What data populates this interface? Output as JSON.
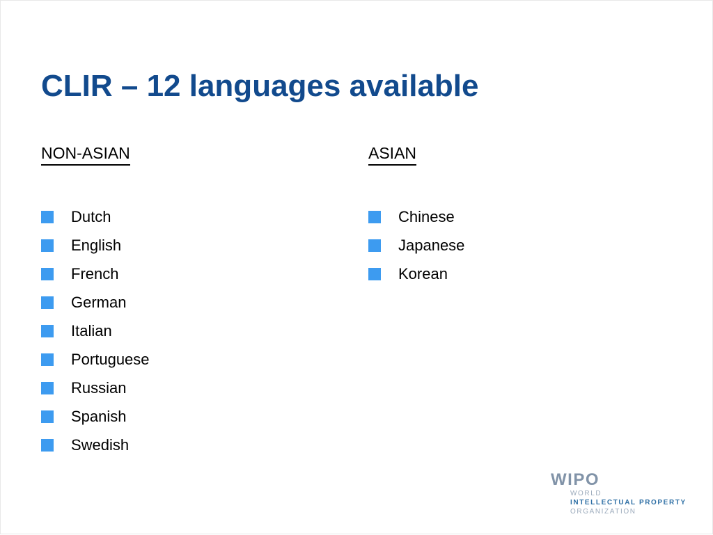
{
  "slide": {
    "title": "CLIR – 12 languages available",
    "title_color": "#124A8D",
    "background_color": "#ffffff",
    "bullet_color": "#3D9BF0"
  },
  "columns": [
    {
      "header": "NON-ASIAN",
      "items": [
        "Dutch",
        "English",
        "French",
        "German",
        "Italian",
        "Portuguese",
        "Russian",
        "Spanish",
        "Swedish"
      ]
    },
    {
      "header": "ASIAN",
      "items": [
        "Chinese",
        "Japanese",
        "Korean"
      ]
    }
  ],
  "logo": {
    "acronym": "WIPO",
    "line1": "WORLD",
    "line2": "INTELLECTUAL PROPERTY",
    "line3": "ORGANIZATION",
    "acronym_color": "#8193A8",
    "accent_color": "#2E6FA5"
  }
}
